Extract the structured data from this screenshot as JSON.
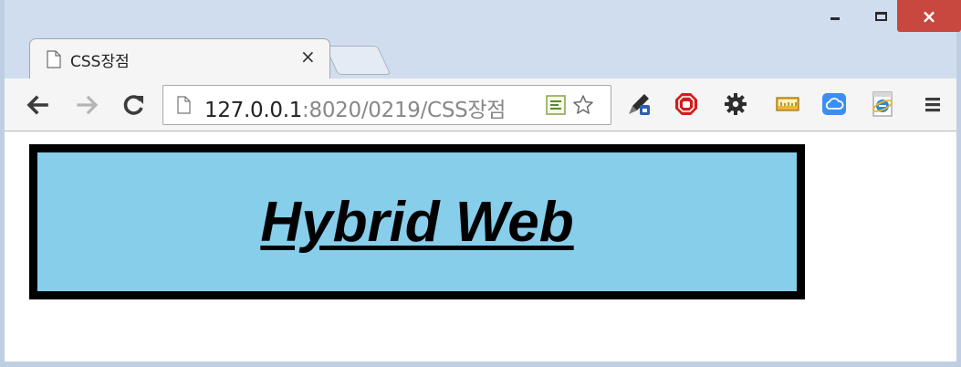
{
  "window": {
    "minimize_symbol": "",
    "maximize_symbol": "",
    "close_symbol": "×"
  },
  "tab": {
    "title": "CSS장점",
    "close_symbol": "×",
    "icon": "page-icon"
  },
  "toolbar": {
    "back_icon": "back-arrow-icon",
    "forward_icon": "forward-arrow-icon",
    "reload_icon": "reload-icon",
    "menu_icon": "hamburger-menu-icon"
  },
  "address_bar": {
    "host": "127.0.0.1",
    "path": ":8020/0219/CSS장점",
    "page_icon": "page-icon",
    "feed_icon": "rss-feed-icon",
    "bookmark_icon": "bookmark-star-icon"
  },
  "extensions": [
    {
      "name": "eyedropper-icon"
    },
    {
      "name": "stop-sign-icon"
    },
    {
      "name": "gear-icon"
    },
    {
      "name": "ruler-icon"
    },
    {
      "name": "cloud-icon"
    },
    {
      "name": "ie-tab-icon"
    }
  ],
  "page": {
    "heading": "Hybrid Web",
    "box_background": "#87ceeb",
    "box_border_color": "#000000"
  },
  "colors": {
    "titlebar": "#cfddee",
    "close_button": "#c8483f",
    "toolbar": "#f5f5f5"
  }
}
